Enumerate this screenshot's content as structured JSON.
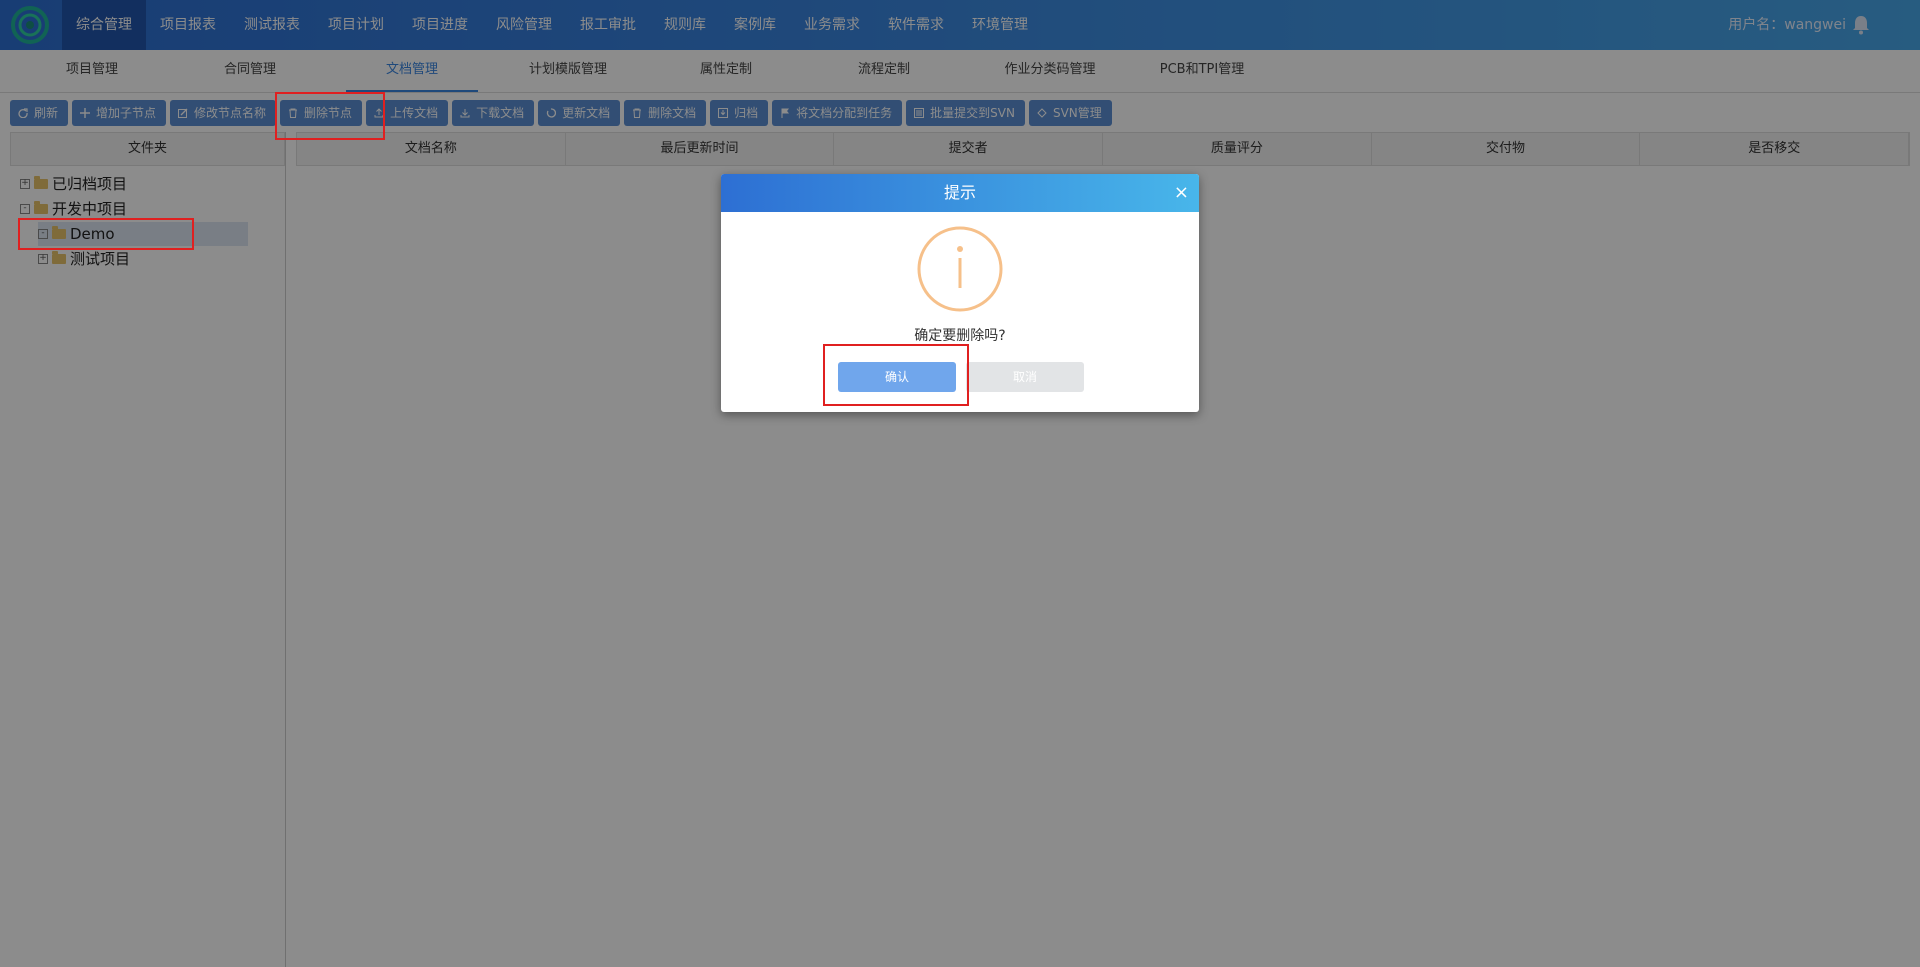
{
  "nav": {
    "items": [
      "综合管理",
      "项目报表",
      "测试报表",
      "项目计划",
      "项目进度",
      "风险管理",
      "报工审批",
      "规则库",
      "案例库",
      "业务需求",
      "软件需求",
      "环境管理"
    ],
    "active_index": 0,
    "user_label": "用户名：",
    "user_name": "wangwei"
  },
  "subtabs": {
    "items": [
      "项目管理",
      "合同管理",
      "文档管理",
      "计划模版管理",
      "属性定制",
      "流程定制",
      "作业分类码管理",
      "PCB和TPI管理"
    ],
    "active_index": 2
  },
  "toolbar": {
    "buttons": [
      {
        "label": "刷新",
        "icon": "refresh-icon"
      },
      {
        "label": "增加子节点",
        "icon": "plus-icon"
      },
      {
        "label": "修改节点名称",
        "icon": "edit-icon"
      },
      {
        "label": "删除节点",
        "icon": "trash-icon"
      },
      {
        "label": "上传文档",
        "icon": "upload-icon"
      },
      {
        "label": "下载文档",
        "icon": "download-icon"
      },
      {
        "label": "更新文档",
        "icon": "update-icon"
      },
      {
        "label": "删除文档",
        "icon": "trash-icon"
      },
      {
        "label": "归档",
        "icon": "archive-icon"
      },
      {
        "label": "将文档分配到任务",
        "icon": "flag-icon"
      },
      {
        "label": "批量提交到SVN",
        "icon": "list-icon"
      },
      {
        "label": "SVN管理",
        "icon": "svn-icon"
      }
    ]
  },
  "left_panel": {
    "header": "文件夹",
    "tree": [
      {
        "label": "已归档项目",
        "expander": "+",
        "level": 0
      },
      {
        "label": "开发中项目",
        "expander": "-",
        "level": 0
      },
      {
        "label": "Demo",
        "expander": "-",
        "level": 1,
        "selected": true
      },
      {
        "label": "测试项目",
        "expander": "+",
        "level": 1
      }
    ]
  },
  "grid": {
    "columns": [
      "文档名称",
      "最后更新时间",
      "提交者",
      "质量评分",
      "交付物",
      "是否移交"
    ]
  },
  "dialog": {
    "title": "提示",
    "close": "×",
    "message": "确定要删除吗?",
    "confirm_label": "确认",
    "cancel_label": "取消",
    "icon": "info-icon"
  },
  "colors": {
    "nav_start": "#2d6fd3",
    "nav_end": "#48a8ea",
    "toolbar_button": "#5b8fd4",
    "confirm_button": "#70a6ec",
    "highlight": "#e02020",
    "info_icon": "#f6c08a"
  }
}
